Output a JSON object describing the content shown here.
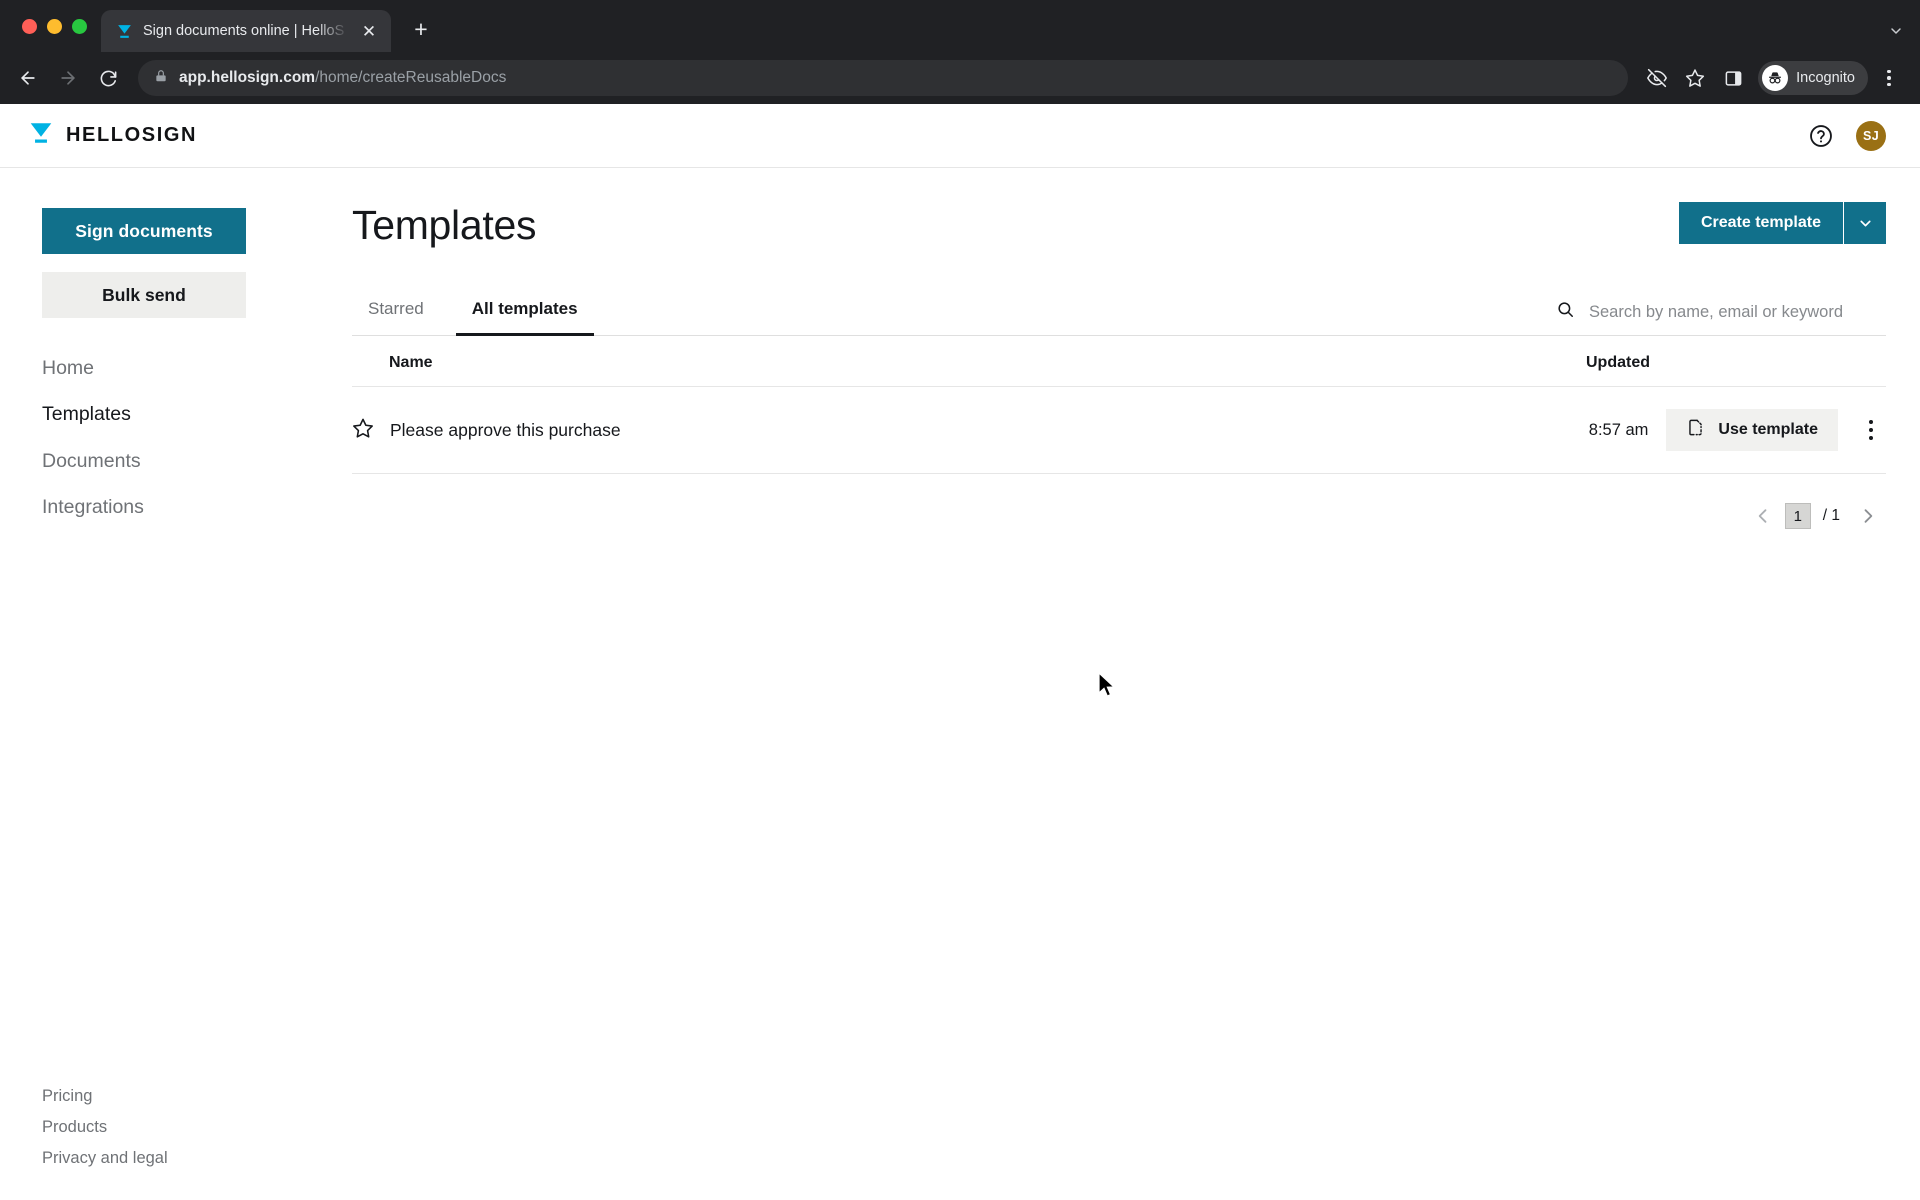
{
  "browser": {
    "tab": {
      "title": "Sign documents online | HelloS",
      "favicon_icon": "hellosign-favicon",
      "close_icon": "close-icon"
    },
    "new_tab_label": "+",
    "tablist_chevron_icon": "chevron-down-icon",
    "nav": {
      "back_icon": "arrow-back-icon",
      "forward_icon": "arrow-forward-icon",
      "reload_icon": "reload-icon"
    },
    "omnibox": {
      "lock_icon": "lock-icon",
      "url_domain": "app.hellosign.com",
      "url_path": "/home/createReusableDocs"
    },
    "toolbar": {
      "tracking_protection_icon": "eye-slash-icon",
      "bookmark_icon": "star-icon",
      "side_panel_icon": "side-panel-icon",
      "incognito_label": "Incognito",
      "incognito_icon": "incognito-icon",
      "menu_icon": "kebab-menu-icon"
    }
  },
  "app": {
    "header": {
      "brand_name": "HELLOSIGN",
      "brand_icon": "hellosign-logo-icon",
      "help_icon": "help-circle-icon",
      "avatar_initials": "SJ",
      "avatar_color": "#9a7014"
    },
    "sidebar": {
      "sign_documents_label": "Sign documents",
      "bulk_send_label": "Bulk send",
      "nav_items": [
        {
          "label": "Home",
          "active": false
        },
        {
          "label": "Templates",
          "active": true
        },
        {
          "label": "Documents",
          "active": false
        },
        {
          "label": "Integrations",
          "active": false
        }
      ],
      "footer_links": [
        {
          "label": "Pricing"
        },
        {
          "label": "Products"
        },
        {
          "label": "Privacy and legal"
        }
      ]
    },
    "main": {
      "page_title": "Templates",
      "create_template_label": "Create template",
      "create_template_caret_icon": "chevron-down-icon",
      "tabs": [
        {
          "label": "Starred",
          "active": false
        },
        {
          "label": "All templates",
          "active": true
        }
      ],
      "search": {
        "icon": "search-icon",
        "placeholder": "Search by name, email or keyword",
        "value": ""
      },
      "table": {
        "columns": [
          {
            "label": "Name"
          },
          {
            "label": "Updated"
          }
        ],
        "rows": [
          {
            "star_icon": "star-outline-icon",
            "name": "Please approve this purchase",
            "updated": "8:57 am",
            "use_template_label": "Use template",
            "use_template_icon": "template-document-icon",
            "more_icon": "kebab-menu-icon"
          }
        ]
      },
      "pagination": {
        "prev_icon": "chevron-left-icon",
        "current_page": "1",
        "total_label": "/ 1",
        "next_icon": "chevron-right-icon"
      }
    },
    "colors": {
      "accent_teal": "#11708b",
      "secondary_gray": "#eeeeec",
      "text_primary": "#16181c",
      "text_muted": "#6f7276"
    }
  }
}
